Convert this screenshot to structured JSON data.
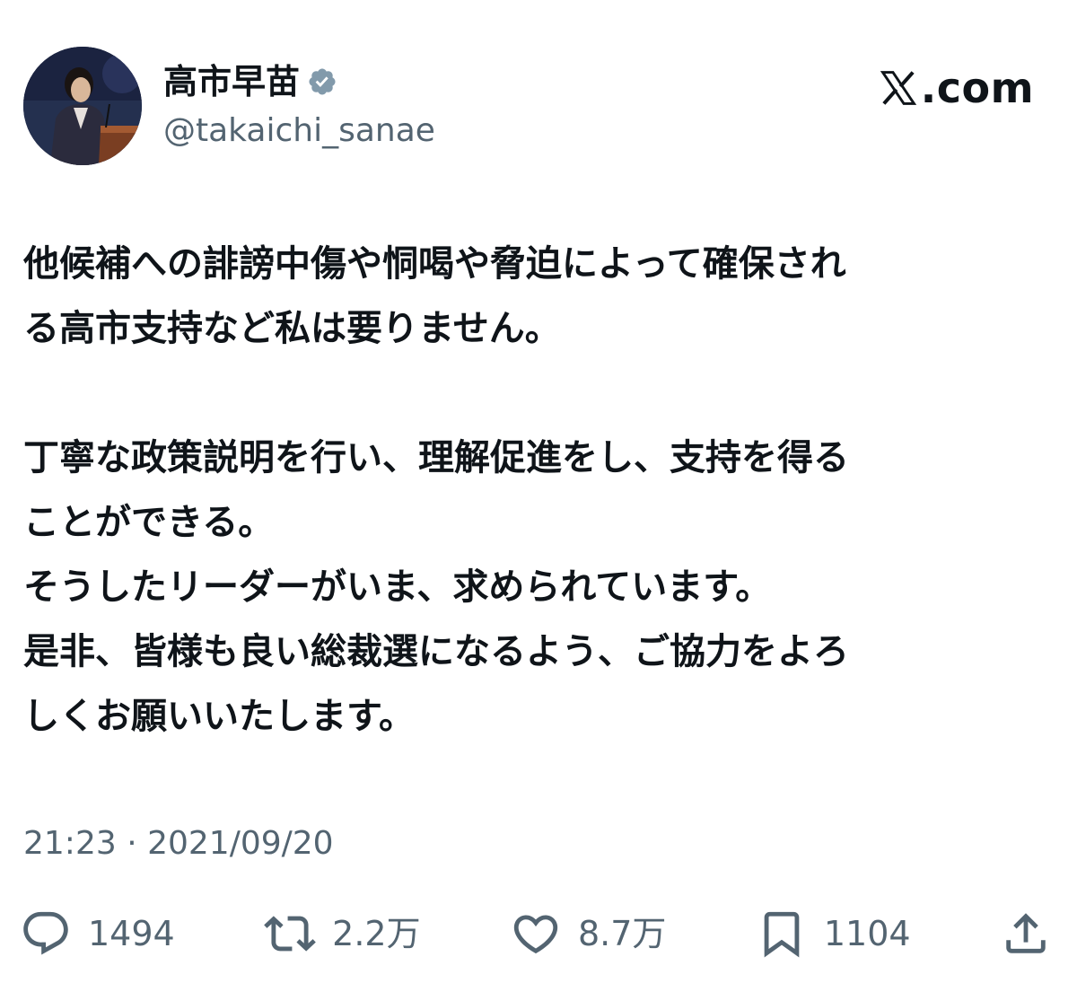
{
  "author": {
    "display_name": "高市早苗",
    "handle": "@takaichi_sanae",
    "verified": true
  },
  "brand": {
    "label": ".com"
  },
  "post": {
    "paragraphs": [
      [
        "他候補への誹謗中傷や恫喝や脅迫によって確保され",
        "る高市支持など私は要りません。"
      ],
      [
        "丁寧な政策説明を行い、理解促進をし、支持を得る",
        "ことができる。",
        "そうしたリーダーがいま、求められています。",
        "是非、皆様も良い総裁選になるよう、ご協力をよろ",
        "しくお願いいたします。"
      ]
    ],
    "timestamp": "21:23 · 2021/09/20"
  },
  "actions": {
    "replies": "1494",
    "reposts": "2.2万",
    "likes": "8.7万",
    "bookmarks": "1104"
  },
  "colors": {
    "text": "#0f1419",
    "secondary": "#536471",
    "verified_badge": "#829aab"
  }
}
